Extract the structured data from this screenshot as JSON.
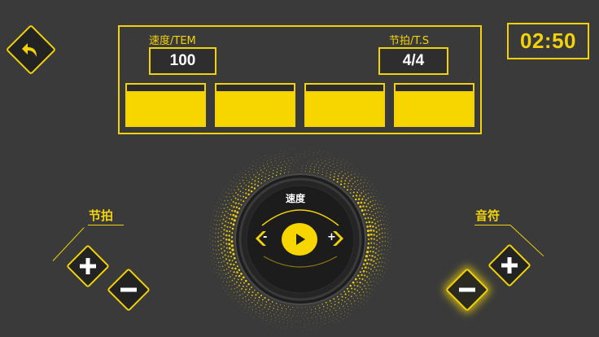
{
  "colors": {
    "accent": "#f2d20a",
    "beat_fill": "#f7d600",
    "background": "#3a3a3a",
    "dark": "#232323",
    "value_text": "#ffffff"
  },
  "header": {
    "back_icon": "back-arrow-icon"
  },
  "panel": {
    "tempo_label": "速度/TEM",
    "tempo_value": "100",
    "time_signature_label": "节拍/T.S",
    "time_signature_value": "4/4",
    "beats": [
      {
        "id": 1,
        "level": 0.8
      },
      {
        "id": 2,
        "level": 0.8
      },
      {
        "id": 3,
        "level": 0.8
      },
      {
        "id": 4,
        "level": 0.8
      }
    ]
  },
  "timer": {
    "value": "02:50"
  },
  "beat_control": {
    "label": "节拍",
    "plus_icon": "plus-icon",
    "minus_icon": "minus-icon"
  },
  "note_control": {
    "label": "音符",
    "plus_icon": "plus-icon",
    "minus_icon": "minus-icon"
  },
  "dial": {
    "label": "速度",
    "decrease_icon": "tempo-decrease-icon",
    "decrease_symbol": "-",
    "increase_icon": "tempo-increase-icon",
    "increase_symbol": "+",
    "play_icon": "play-icon"
  }
}
